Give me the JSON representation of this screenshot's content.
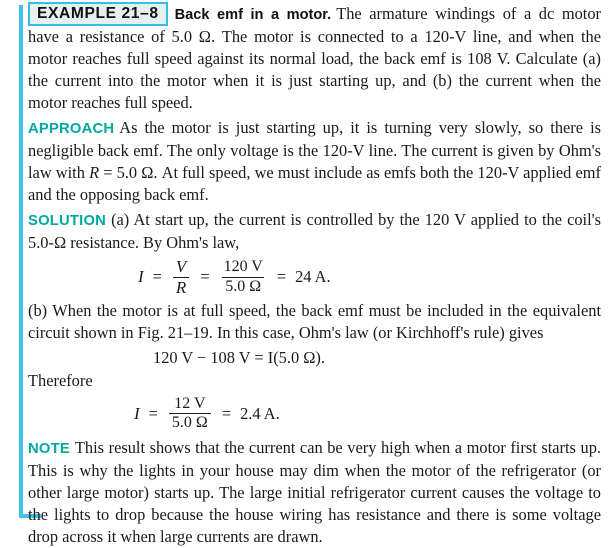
{
  "colors": {
    "rule": "#3fc3ea",
    "tag_border": "#33bfe8",
    "tag_fill": "#e6f0f0",
    "section_label": "#00a99d",
    "text": "#1a1a1a"
  },
  "example": {
    "tag": "EXAMPLE 21–8",
    "title": "Back emf in a motor.",
    "problem_text": "The armature windings of a dc motor have a resistance of 5.0 Ω. The motor is connected to a 120-V line, and when the motor reaches full speed against its normal load, the back emf is 108 V. Calculate (a) the current into the motor when it is just starting up, and (b) the current when the motor reaches full speed."
  },
  "approach": {
    "label": "APPROACH",
    "text_before_R": "As the motor is just starting up, it is turning very slowly, so there is negligible back emf. The only voltage is the 120-V line. The current is given by Ohm's law with",
    "R_symbol": "R",
    "text_after_R": "= 5.0 Ω. At full speed, we must include as emfs both the 120-V applied emf and the opposing back emf."
  },
  "solution": {
    "label": "SOLUTION",
    "part_a_text": "(a) At start up, the current is controlled by the 120 V applied to the coil's 5.0-Ω resistance. By Ohm's law,",
    "equation_a": {
      "lhs": "I",
      "eq1": "=",
      "frac1_num": "V",
      "frac1_den": "R",
      "eq2": "=",
      "frac2_num": "120 V",
      "frac2_den": "5.0 Ω",
      "eq3": "=",
      "result": "24 A."
    },
    "part_b_text": "(b) When the motor is at full speed, the back emf must be included in the equivalent circuit shown in Fig. 21–19. In this case, Ohm's law (or Kirchhoff's rule) gives",
    "equation_b": {
      "line": "120 V − 108 V  =  I(5.0 Ω)."
    },
    "therefore": "Therefore",
    "equation_c": {
      "lhs": "I",
      "eq1": "=",
      "frac_num": "12 V",
      "frac_den": "5.0 Ω",
      "eq2": "=",
      "result": "2.4 A."
    }
  },
  "note": {
    "label": "NOTE",
    "text": "This result shows that the current can be very high when a motor first starts up. This is why the lights in your house may dim when the motor of the refrigerator (or other large motor) starts up. The large initial refrigerator current causes the voltage to the lights to drop because the house wiring has resistance and there is some voltage drop across it when large currents are drawn."
  }
}
